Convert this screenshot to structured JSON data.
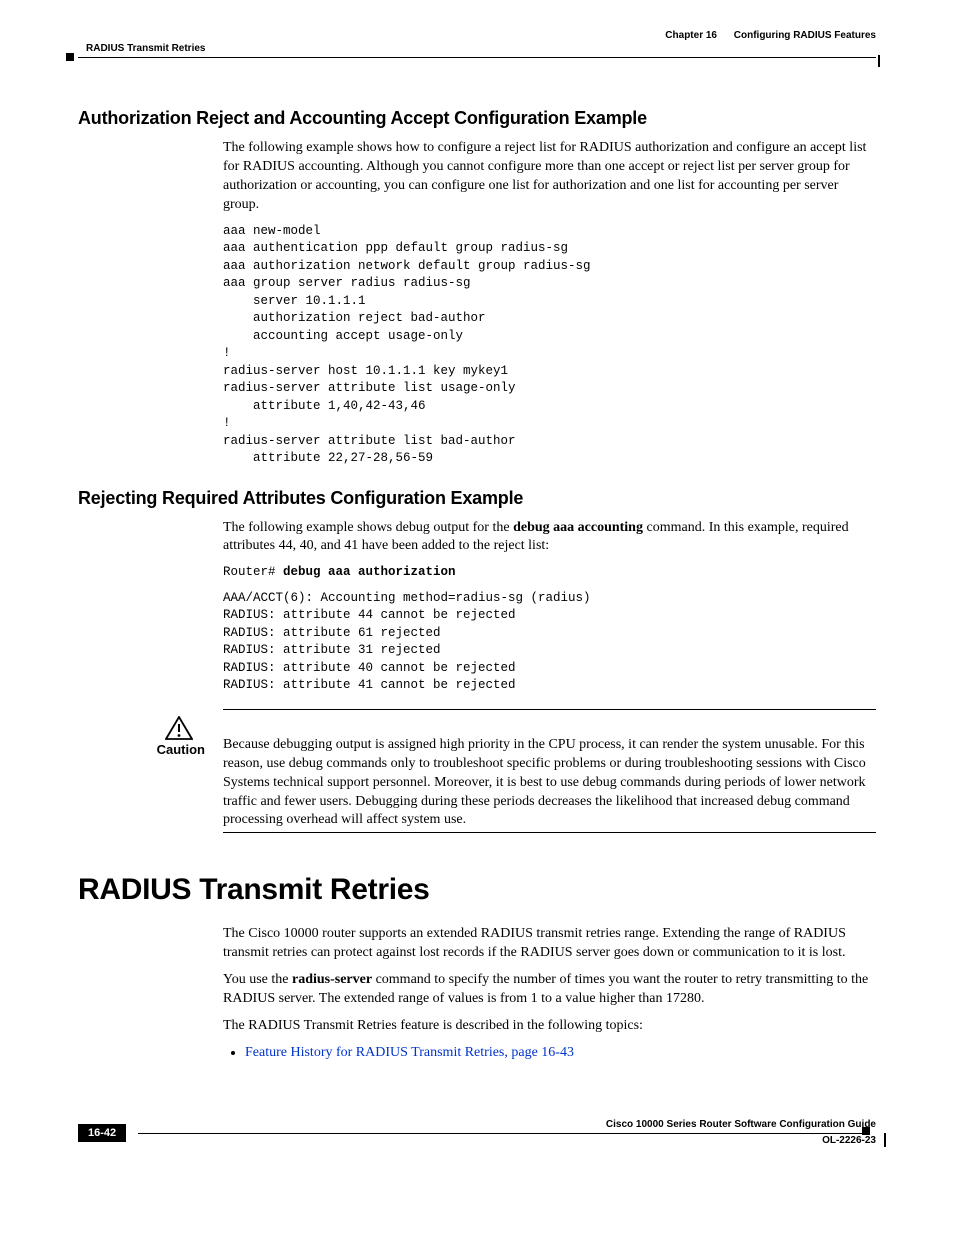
{
  "header": {
    "chapter": "Chapter 16",
    "chapter_title": "Configuring RADIUS Features",
    "section": "RADIUS Transmit Retries"
  },
  "sec1": {
    "title": "Authorization Reject and Accounting Accept Configuration Example",
    "intro": "The following example shows how to configure a reject list for RADIUS authorization and configure an accept list for RADIUS accounting. Although you cannot configure more than one accept or reject list per server group for authorization or accounting, you can configure one list for authorization and one list for accounting per server group.",
    "code": "aaa new-model\naaa authentication ppp default group radius-sg\naaa authorization network default group radius-sg\naaa group server radius radius-sg\n    server 10.1.1.1\n    authorization reject bad-author\n    accounting accept usage-only\n!\nradius-server host 10.1.1.1 key mykey1\nradius-server attribute list usage-only\n    attribute 1,40,42-43,46\n!\nradius-server attribute list bad-author\n    attribute 22,27-28,56-59"
  },
  "sec2": {
    "title": "Rejecting Required Attributes Configuration Example",
    "intro_pre": "The following example shows debug output for the ",
    "intro_bold": "debug aaa accounting",
    "intro_post": " command. In this example, required attributes 44, 40, and 41 have been added to the reject list:",
    "prompt": "Router# ",
    "cmd": "debug aaa authorization",
    "output": "AAA/ACCT(6): Accounting method=radius-sg (radius)\nRADIUS: attribute 44 cannot be rejected\nRADIUS: attribute 61 rejected\nRADIUS: attribute 31 rejected\nRADIUS: attribute 40 cannot be rejected\nRADIUS: attribute 41 cannot be rejected"
  },
  "caution": {
    "label": "Caution",
    "text": "Because debugging output is assigned high priority in the CPU process, it can render the system unusable. For this reason, use debug commands only to troubleshoot specific problems or during troubleshooting sessions with Cisco Systems technical support personnel. Moreover, it is best to use debug commands during periods of lower network traffic and fewer users. Debugging during these periods decreases the likelihood that increased debug command processing overhead will affect system use."
  },
  "sec3": {
    "title": "RADIUS Transmit Retries",
    "p1": "The Cisco 10000 router supports an extended RADIUS transmit retries range. Extending the range of RADIUS transmit retries can protect against lost records if the RADIUS server goes down or communication to it is lost.",
    "p2_pre": "You use the ",
    "p2_bold": "radius-server",
    "p2_post": " command to specify the number of times you want the router to retry transmitting to the RADIUS server. The extended range of values is from 1 to a value higher than 17280.",
    "p3": "The RADIUS Transmit Retries feature is described in the following topics:",
    "link": "Feature History for RADIUS Transmit Retries, page 16-43"
  },
  "footer": {
    "guide": "Cisco 10000 Series Router Software Configuration Guide",
    "page": "16-42",
    "doc": "OL-2226-23"
  }
}
